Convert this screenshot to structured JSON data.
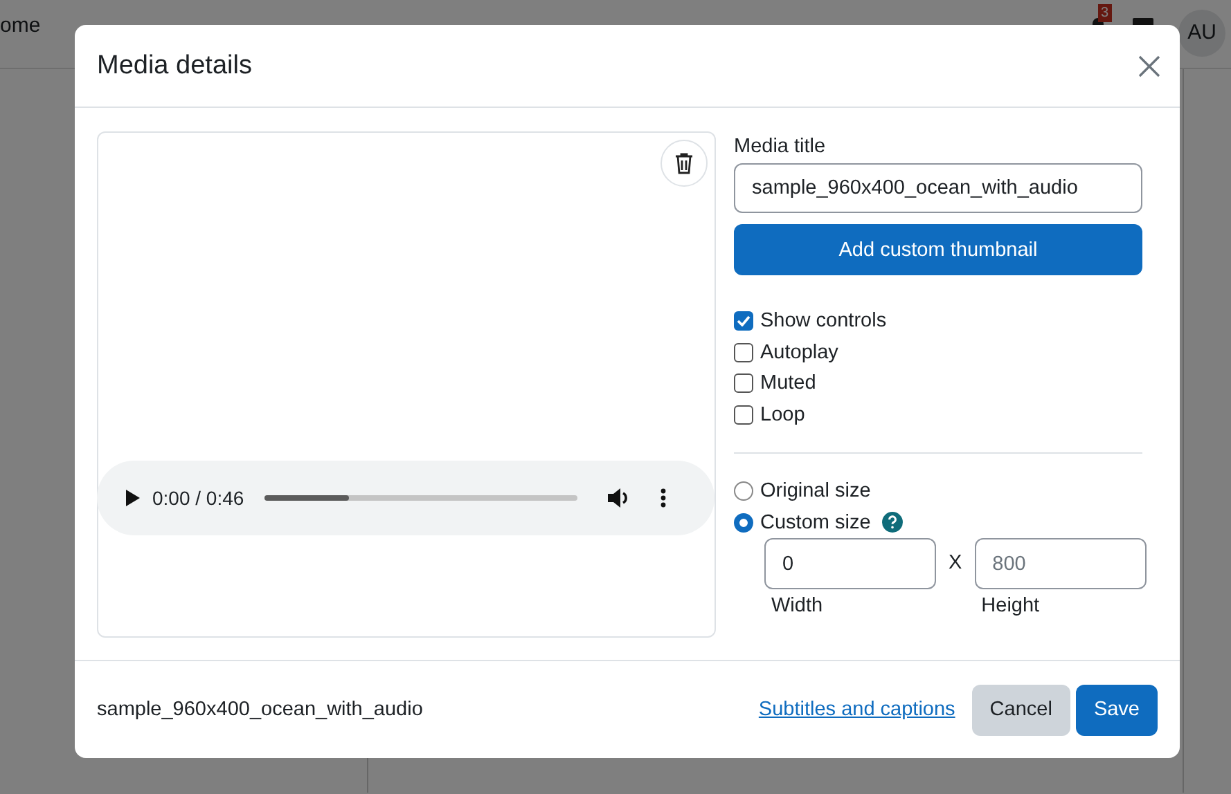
{
  "navbar": {
    "items": [
      "ome"
    ],
    "notification_count": "3",
    "avatar": "AU"
  },
  "dialog": {
    "title": "Media details",
    "player": {
      "time": "0:00 / 0:46",
      "level": 0.27
    },
    "media_title": {
      "label": "Media title",
      "value": "sample_960x400_ocean_with_audio"
    },
    "thumbnail_button": "Add custom thumbnail",
    "options": [
      {
        "label": "Show controls",
        "checked": true
      },
      {
        "label": "Autoplay",
        "checked": false
      },
      {
        "label": "Muted",
        "checked": false
      },
      {
        "label": "Loop",
        "checked": false
      }
    ],
    "size_options": [
      {
        "label": "Original size",
        "selected": false,
        "help": false
      },
      {
        "label": "Custom size",
        "selected": true,
        "help": true
      }
    ],
    "width": {
      "value": "0",
      "label": "Width"
    },
    "separator": "X",
    "height": {
      "placeholder": "800",
      "label": "Height"
    },
    "footer": {
      "filename": "sample_960x400_ocean_with_audio",
      "link": "Subtitles and captions",
      "buttons": [
        {
          "label": "Cancel",
          "kind": "secondary"
        },
        {
          "label": "Save",
          "kind": "primary"
        }
      ]
    }
  }
}
